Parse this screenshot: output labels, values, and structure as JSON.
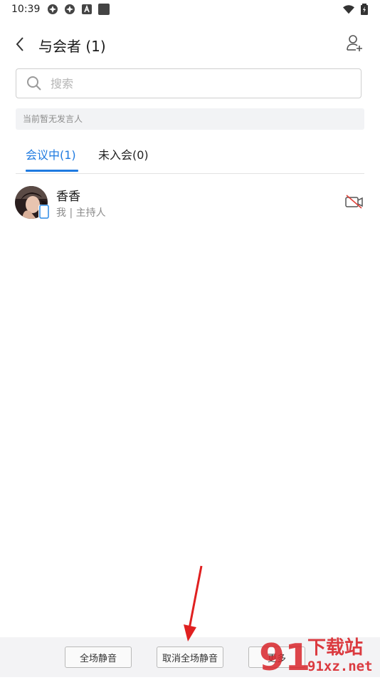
{
  "status": {
    "time": "10:39"
  },
  "header": {
    "title": "与会者 (1)"
  },
  "search": {
    "placeholder": "搜索"
  },
  "speaker_text": "当前暂无发言人",
  "tabs": [
    {
      "label": "会议中(1)",
      "active": true
    },
    {
      "label": "未入会(0)",
      "active": false
    }
  ],
  "participants": [
    {
      "name": "香香",
      "role": "我 | 主持人",
      "device": "phone-icon",
      "camera": "camera-off-icon"
    }
  ],
  "bottom_buttons": [
    {
      "label": "全场静音"
    },
    {
      "label": "取消全场静音"
    },
    {
      "label": "更多"
    }
  ],
  "watermark": {
    "brand": "下载站",
    "site": "91xz.net",
    "logo_text": "91"
  },
  "colors": {
    "accent": "#1f7ae0",
    "annotation_arrow": "#e02020",
    "watermark": "#d9262c"
  }
}
